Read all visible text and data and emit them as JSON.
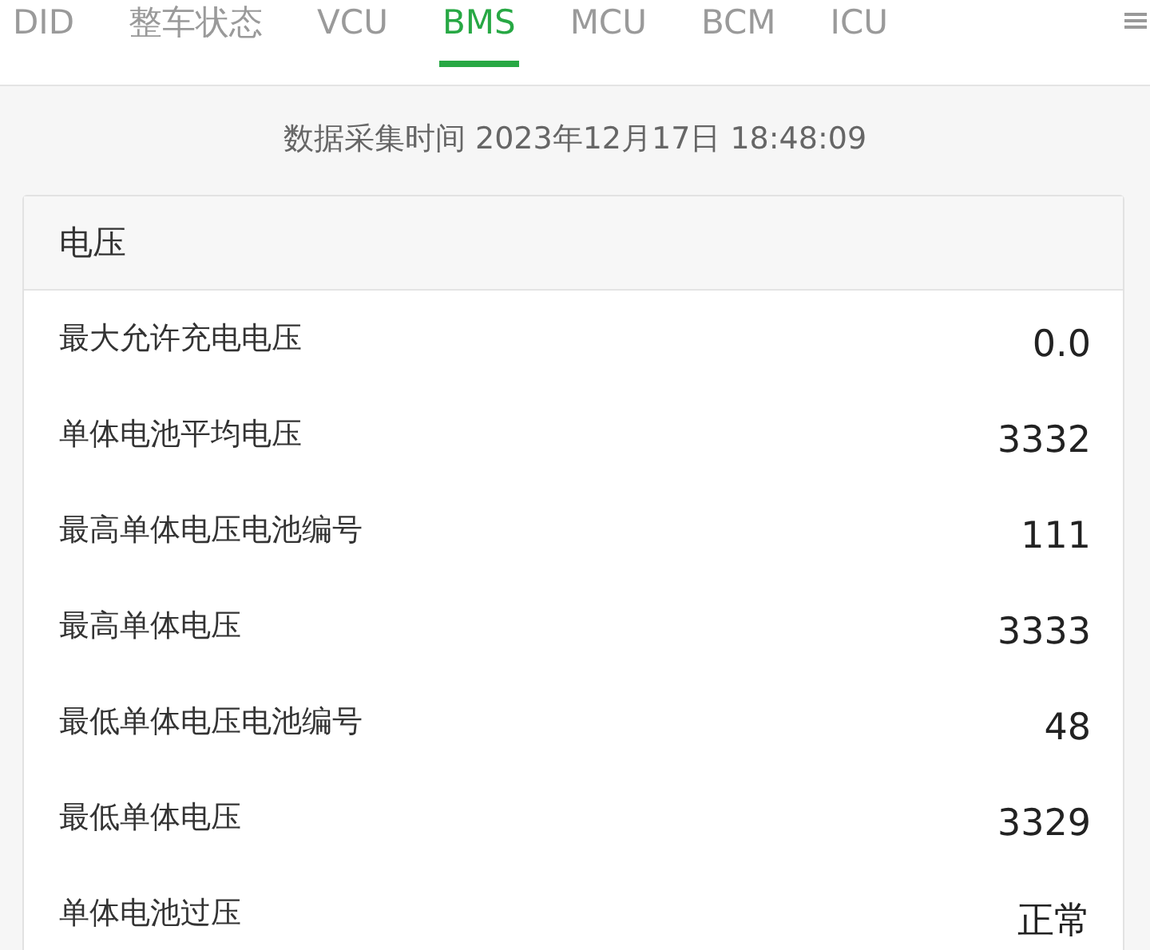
{
  "tabs": [
    {
      "label": "DID",
      "selected": false
    },
    {
      "label": "整车状态",
      "selected": false
    },
    {
      "label": "VCU",
      "selected": false
    },
    {
      "label": "BMS",
      "selected": true
    },
    {
      "label": "MCU",
      "selected": false
    },
    {
      "label": "BCM",
      "selected": false
    },
    {
      "label": "ICU",
      "selected": false
    }
  ],
  "collection_time": "数据采集时间 2023年12月17日 18:48:09",
  "section": {
    "title": "电压",
    "rows": [
      {
        "label": "最大允许充电电压",
        "value": "0.0"
      },
      {
        "label": "单体电池平均电压",
        "value": "3332"
      },
      {
        "label": "最高单体电压电池编号",
        "value": "111"
      },
      {
        "label": "最高单体电压",
        "value": "3333"
      },
      {
        "label": "最低单体电压电池编号",
        "value": "48"
      },
      {
        "label": "最低单体电压",
        "value": "3329"
      },
      {
        "label": "单体电池过压",
        "value": "正常"
      }
    ]
  }
}
